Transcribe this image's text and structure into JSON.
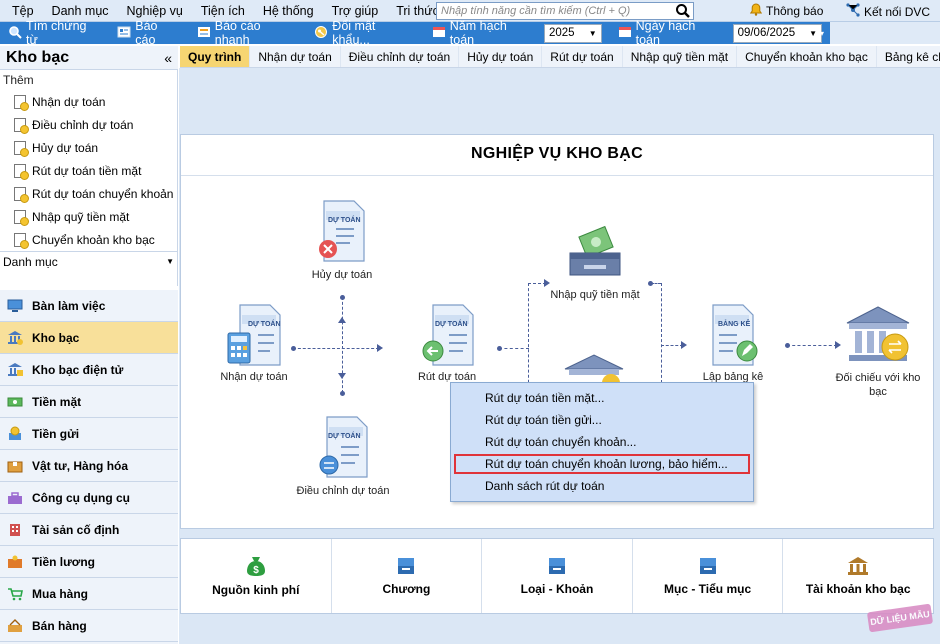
{
  "menu": {
    "items": [
      "Tệp",
      "Danh mục",
      "Nghiệp vụ",
      "Tiện ích",
      "Hệ thống",
      "Trợ giúp",
      "Tri thức"
    ],
    "search_placeholder": "Nhập tính năng cần tìm kiếm (Ctrl + Q)",
    "notification": "Thông báo",
    "connect": "Kết nối DVC"
  },
  "toolbar": {
    "find_voucher": "Tìm chứng từ",
    "report": "Báo cáo",
    "quick_report": "Báo cáo nhanh",
    "change_password": "Đổi mật khẩu...",
    "fiscal_year_label": "Năm hạch toán",
    "fiscal_year": "2025",
    "accounting_date_label": "Ngày hạch toán",
    "accounting_date": "09/06/2025"
  },
  "sidebar": {
    "title": "Kho bạc",
    "collapse": "«",
    "section_add": "Thêm",
    "add_items": [
      "Nhận dự toán",
      "Điều chỉnh dự toán",
      "Hủy dự toán",
      "Rút dự toán tiền mặt",
      "Rút dự toán chuyển khoản",
      "Nhập quỹ tiền mặt",
      "Chuyển khoản kho bạc"
    ],
    "section_catalog": "Danh mục",
    "nav": [
      "Bàn làm việc",
      "Kho bạc",
      "Kho bạc điện tử",
      "Tiền mặt",
      "Tiền gửi",
      "Vật tư, Hàng hóa",
      "Công cụ dụng cụ",
      "Tài sản cố định",
      "Tiền lương",
      "Mua hàng",
      "Bán hàng"
    ],
    "active_nav": "Kho bạc"
  },
  "tabs": [
    "Quy trình",
    "Nhận dự toán",
    "Điều chỉnh dự toán",
    "Hủy dự toán",
    "Rút dự toán",
    "Nhập quỹ tiền mặt",
    "Chuyển khoản kho bạc",
    "Bảng kê chứng từ thanh"
  ],
  "active_tab": "Quy trình",
  "diagram": {
    "title": "NGHIỆP VỤ KHO BẠC",
    "doc_tag": "DỰ TOÁN",
    "list_tag": "BẢNG KÊ",
    "nodes": {
      "cancel": "Hủy dự toán",
      "receive": "Nhận dự toán",
      "withdraw": "Rút dự toán",
      "adjust": "Điều chỉnh dự toán",
      "cash_in": "Nhập quỹ tiền mặt",
      "list": "Lập bảng kê",
      "reconcile": "Đối chiếu với kho bạc"
    }
  },
  "popup": {
    "items": [
      "Rút dự toán tiền mặt...",
      "Rút dự toán tiền gửi...",
      "Rút dự toán chuyển khoản...",
      "Rút dự toán chuyển khoản lương, bảo hiểm...",
      "Danh sách rút dự toán"
    ],
    "highlighted_index": 3
  },
  "catalog": [
    "Nguồn kinh phí",
    "Chương",
    "Loại - Khoản",
    "Mục - Tiểu mục",
    "Tài khoản kho bạc"
  ],
  "watermark": "DỮ LIỆU MẪU"
}
